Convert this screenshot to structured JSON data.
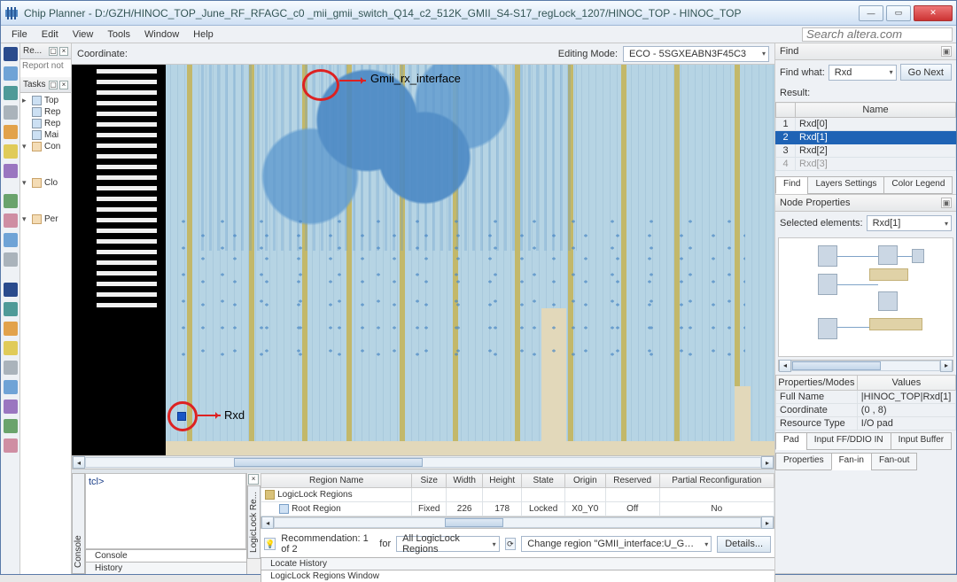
{
  "titlebar": {
    "title": "Chip Planner - D:/GZH/HINOC_TOP_June_RF_RFAGC_c0 _mii_gmii_switch_Q14_c2_512K_GMII_S4-S17_regLock_1207/HINOC_TOP - HINOC_TOP"
  },
  "menu": {
    "file": "File",
    "edit": "Edit",
    "view": "View",
    "tools": "Tools",
    "window": "Window",
    "help": "Help",
    "search": "Search altera.com"
  },
  "leftpanes": {
    "reports": {
      "title": "Re...",
      "subtitle": "Report not"
    },
    "tasks": {
      "title": "Tasks",
      "items": [
        "Top",
        "Rep",
        "Rep",
        "Mai",
        "Con",
        "Clo",
        "Per"
      ]
    }
  },
  "center": {
    "coord_label": "Coordinate:",
    "edit_label": "Editing Mode:",
    "edit_value": "ECO - 5SGXEABN3F45C3",
    "annot1": "Gmii_rx_interface",
    "annot2": "Rxd"
  },
  "right": {
    "find_title": "Find",
    "findwhat_label": "Find what:",
    "findwhat_value": "Rxd",
    "gonext": "Go Next",
    "result_label": "Result:",
    "name_header": "Name",
    "results": [
      {
        "n": "1",
        "name": "Rxd[0]"
      },
      {
        "n": "2",
        "name": "Rxd[1]"
      },
      {
        "n": "3",
        "name": "Rxd[2]"
      },
      {
        "n": "4",
        "name": "Rxd[3]"
      }
    ],
    "tabs": {
      "find": "Find",
      "layers": "Layers Settings",
      "color": "Color Legend"
    },
    "nodeprop_title": "Node Properties",
    "selelem_label": "Selected elements:",
    "selelem_value": "Rxd[1]",
    "props_header1": "Properties/Modes",
    "props_header2": "Values",
    "props": [
      {
        "k": "Full Name",
        "v": "|HINOC_TOP|Rxd[1]"
      },
      {
        "k": "Coordinate",
        "v": "(0 , 8)"
      },
      {
        "k": "Resource Type",
        "v": "I/O pad"
      }
    ],
    "subtabs": {
      "pad": "Pad",
      "inputff": "Input FF/DDIO IN",
      "inputbuf": "Input Buffer"
    },
    "bottomtabs": {
      "props": "Properties",
      "fanin": "Fan-in",
      "fanout": "Fan-out"
    }
  },
  "logiclock": {
    "title": "LogicLock Re...",
    "cols": [
      "Region Name",
      "Size",
      "Width",
      "Height",
      "State",
      "Origin",
      "Reserved",
      "Partial Reconfiguration"
    ],
    "row_group": "LogicLock Regions",
    "row": {
      "name": "Root Region",
      "size": "Fixed",
      "width": "226",
      "height": "178",
      "state": "Locked",
      "origin": "X0_Y0",
      "reserved": "Off",
      "partial": "No"
    },
    "rec_label": "Recommendation: 1 of 2",
    "rec_for": "for",
    "rec_combo": "All LogicLock Regions",
    "rec_action": "Change region \"GMII_interface:U_GMII_interface\" to",
    "details": "Details...",
    "tabs": {
      "locate": "Locate History",
      "ll": "LogicLock Regions Window"
    }
  },
  "console": {
    "label": "Console",
    "prompt": "tcl>",
    "tabs": {
      "console": "Console",
      "history": "History"
    }
  }
}
